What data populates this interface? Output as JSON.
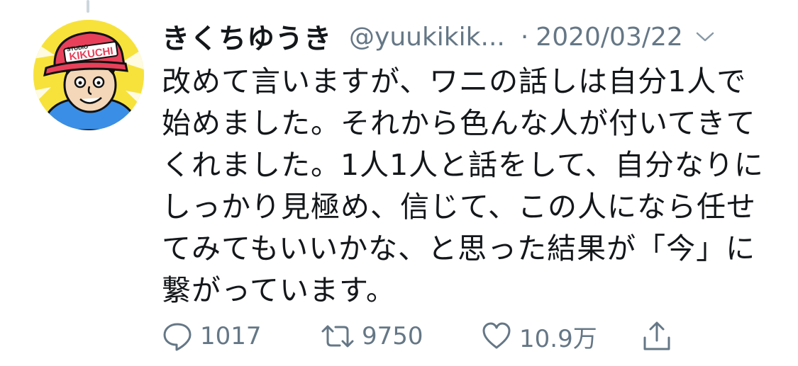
{
  "tweet": {
    "display_name": "きくちゆうき",
    "handle": "@yuukikik...",
    "separator": "·",
    "date": "2020/03/22",
    "avatar_text": {
      "studio": "STUDIO",
      "name": "KIKUCHI"
    },
    "text_lines": [
      "改めて言いますが、ワニの話しは自分1人で",
      "始めました。それから色んな人が付いてきて",
      "くれました。1人1人と話をして、自分なりに",
      "しっかり見極め、信じて、この人になら任せ",
      "てみてもいいかな、と思った結果が「今」に",
      "繋がっています。"
    ],
    "actions": {
      "reply_count": "1017",
      "retweet_count": "9750",
      "like_count": "10.9万"
    }
  },
  "icons": {
    "reply": "reply-icon",
    "retweet": "retweet-icon",
    "like": "heart-icon",
    "share": "share-icon",
    "caret": "chevron-down-icon"
  },
  "colors": {
    "text": "#14171a",
    "secondary": "#657786",
    "avatar_bg": "#f7e23c",
    "cap": "#e8405a",
    "shirt": "#3a8ee6"
  }
}
